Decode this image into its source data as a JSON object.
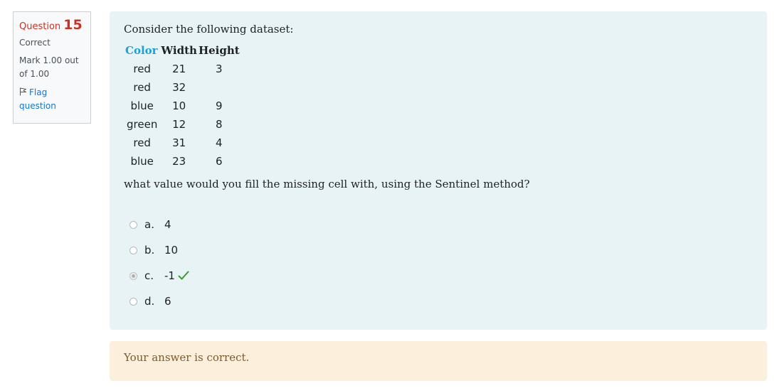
{
  "info": {
    "question_label": "Question",
    "question_number": "15",
    "state": "Correct",
    "grade": "Mark 1.00 out of 1.00",
    "flag_label": "Flag question"
  },
  "question": {
    "intro": "Consider the following dataset:",
    "table": {
      "headers": [
        "Color",
        "Width",
        "Height"
      ],
      "rows": [
        [
          "red",
          "21",
          "3"
        ],
        [
          "red",
          "32",
          ""
        ],
        [
          "blue",
          "10",
          "9"
        ],
        [
          "green",
          "12",
          "8"
        ],
        [
          "red",
          "31",
          "4"
        ],
        [
          "blue",
          "23",
          "6"
        ]
      ]
    },
    "prompt": "what value would you fill the missing cell with, using the Sentinel method?",
    "options": [
      {
        "letter": "a.",
        "value": "4",
        "selected": false
      },
      {
        "letter": "b.",
        "value": "10",
        "selected": false
      },
      {
        "letter": "c.",
        "value": "-1",
        "selected": true,
        "correct": true
      },
      {
        "letter": "d.",
        "value": "6",
        "selected": false
      }
    ]
  },
  "feedback": "Your answer is correct.",
  "colors": {
    "accent": "#1aa1d8",
    "question_red": "#ca3120",
    "content_bg": "#e7f3f5",
    "feedback_bg": "#fcefdc",
    "check_green": "#3a9a34"
  }
}
